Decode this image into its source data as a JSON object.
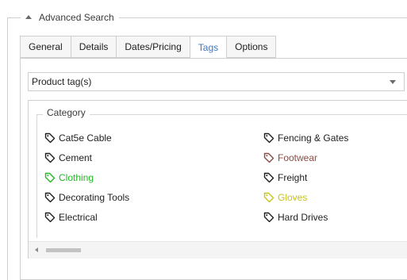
{
  "advanced_search": {
    "title": "Advanced Search"
  },
  "tabs": [
    {
      "label": "General"
    },
    {
      "label": "Details"
    },
    {
      "label": "Dates/Pricing"
    },
    {
      "label": "Tags",
      "active": true
    },
    {
      "label": "Options"
    }
  ],
  "tag_selector": {
    "value": "Product tag(s)"
  },
  "category": {
    "title": "Category",
    "left_items": [
      {
        "label": "Cat5e Cable",
        "color": "#1e1e1e",
        "icon": "tag-icon"
      },
      {
        "label": "Cement",
        "color": "#1e1e1e",
        "icon": "tag-icon"
      },
      {
        "label": "Clothing",
        "color": "#22b826",
        "icon": "tag-icon"
      },
      {
        "label": "Decorating Tools",
        "color": "#1e1e1e",
        "icon": "tag-icon"
      },
      {
        "label": "Electrical",
        "color": "#1e1e1e",
        "icon": "tag-icon"
      }
    ],
    "right_items": [
      {
        "label": "Fencing & Gates",
        "color": "#1e1e1e",
        "icon": "tag-icon"
      },
      {
        "label": "Footwear",
        "color": "#8b4a45",
        "icon": "tag-icon"
      },
      {
        "label": "Freight",
        "color": "#1e1e1e",
        "icon": "tag-icon"
      },
      {
        "label": "Gloves",
        "color": "#c8c21c",
        "icon": "tag-icon"
      },
      {
        "label": "Hard Drives",
        "color": "#1e1e1e",
        "icon": "tag-icon"
      }
    ]
  }
}
